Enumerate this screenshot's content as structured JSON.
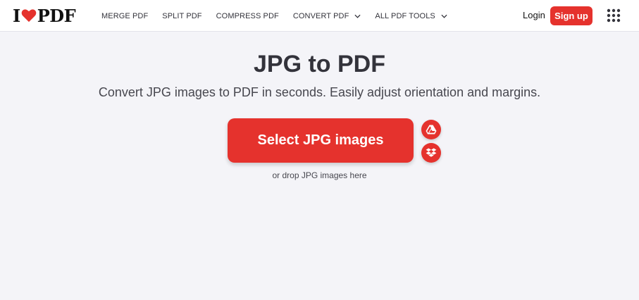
{
  "brand": {
    "logo_left": "I",
    "logo_right": "PDF",
    "accent_color": "#e5322d"
  },
  "nav": {
    "items": [
      {
        "label": "MERGE PDF",
        "dropdown": false
      },
      {
        "label": "SPLIT PDF",
        "dropdown": false
      },
      {
        "label": "COMPRESS PDF",
        "dropdown": false
      },
      {
        "label": "CONVERT PDF",
        "dropdown": true
      },
      {
        "label": "ALL PDF TOOLS",
        "dropdown": true
      }
    ]
  },
  "account": {
    "login_label": "Login",
    "signup_label": "Sign up",
    "apps_icon": "grid-icon"
  },
  "main": {
    "title": "JPG to PDF",
    "subtitle": "Convert JPG images to PDF in seconds. Easily adjust orientation and margins.",
    "select_label": "Select JPG images",
    "drop_hint": "or drop JPG images here",
    "cloud_icons": [
      "google-drive-icon",
      "dropbox-icon"
    ]
  }
}
